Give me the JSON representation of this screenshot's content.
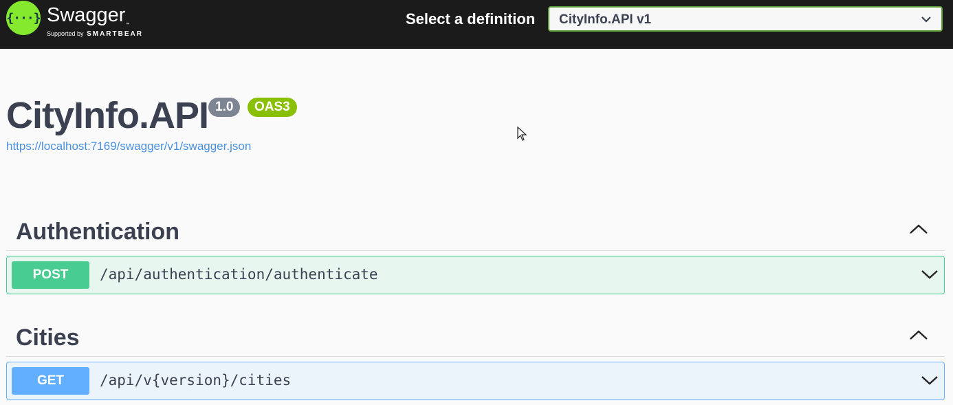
{
  "topbar": {
    "logo": {
      "icon": "swagger-logo-icon",
      "icon_glyph": "{···}",
      "name": "Swagger",
      "trademark": "™",
      "supported_by": "Supported by",
      "company": "SMARTBEAR"
    },
    "definition_label": "Select a definition",
    "definition_selected": "CityInfo.API v1",
    "accent_color": "#62a03f"
  },
  "info": {
    "title": "CityInfo.API",
    "version": "1.0",
    "oas_badge": "OAS3",
    "spec_url": "https://localhost:7169/swagger/v1/swagger.json"
  },
  "sections": [
    {
      "name": "Authentication",
      "operations": [
        {
          "method": "POST",
          "path": "/api/authentication/authenticate",
          "color": "#49cc90"
        }
      ]
    },
    {
      "name": "Cities",
      "operations": [
        {
          "method": "GET",
          "path": "/api/v{version}/cities",
          "color": "#61affe"
        }
      ]
    }
  ]
}
